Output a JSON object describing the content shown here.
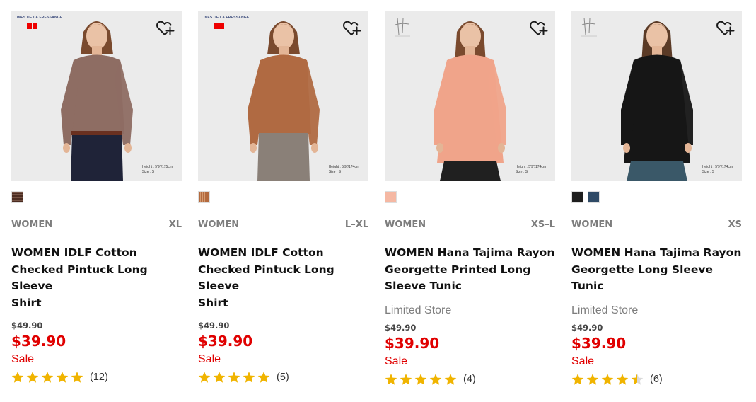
{
  "products": [
    {
      "brand_text": "INES DE LA FRESSANGE",
      "model_meta": [
        "Height : 5'9\"/175cm",
        "Size : S"
      ],
      "swatch_colors": [
        "#8a6a5c"
      ],
      "gender": "WOMEN",
      "size": "XL",
      "name_lines": [
        "WOMEN IDLF Cotton",
        "Checked Pintuck Long Sleeve",
        "Shirt"
      ],
      "limited": "",
      "original_price": "$49.90",
      "price": "$39.90",
      "sale": "Sale",
      "stars": 5,
      "review_count": "(12)",
      "shirt_color": "#8e6d63",
      "bottom_color": "#1f2338"
    },
    {
      "brand_text": "INES DE LA FRESSANGE",
      "model_meta": [
        "Height : 5'9\"/174cm",
        "Size : S"
      ],
      "swatch_colors": [
        "#b36a3e"
      ],
      "gender": "WOMEN",
      "size": "L–XL",
      "name_lines": [
        "WOMEN IDLF Cotton",
        "Checked Pintuck Long Sleeve",
        "Shirt"
      ],
      "limited": "",
      "original_price": "$49.90",
      "price": "$39.90",
      "sale": "Sale",
      "stars": 5,
      "review_count": "(5)",
      "shirt_color": "#b06a42",
      "bottom_color": "#8a8078"
    },
    {
      "brand_text": "",
      "model_meta": [
        "Height : 5'9\"/174cm",
        "Size : S"
      ],
      "swatch_colors": [
        "#f5b8a3"
      ],
      "gender": "WOMEN",
      "size": "XS–L",
      "name_lines": [
        "WOMEN Hana Tajima Rayon",
        "Georgette Printed Long",
        "Sleeve Tunic"
      ],
      "limited": "Limited Store",
      "original_price": "$49.90",
      "price": "$39.90",
      "sale": "Sale",
      "stars": 5,
      "review_count": "(4)",
      "shirt_color": "#f0a48a",
      "bottom_color": "#202020"
    },
    {
      "brand_text": "",
      "model_meta": [
        "Height : 5'9\"/174cm",
        "Size : S"
      ],
      "swatch_colors": [
        "#1e1e1e",
        "#2f4a66"
      ],
      "gender": "WOMEN",
      "size": "XS",
      "name_lines": [
        "WOMEN Hana Tajima Rayon",
        "Georgette Long Sleeve Tunic"
      ],
      "limited": "Limited Store",
      "original_price": "$49.90",
      "price": "$39.90",
      "sale": "Sale",
      "stars": 4.5,
      "review_count": "(6)",
      "shirt_color": "#161616",
      "bottom_color": "#3a5868"
    }
  ],
  "colors": {
    "sale_red": "#e00000",
    "star_gold": "#f0b400",
    "muted_text": "#7d7d7d"
  },
  "icons": {
    "favorite": "heart-plus-icon",
    "star": "star-icon"
  }
}
